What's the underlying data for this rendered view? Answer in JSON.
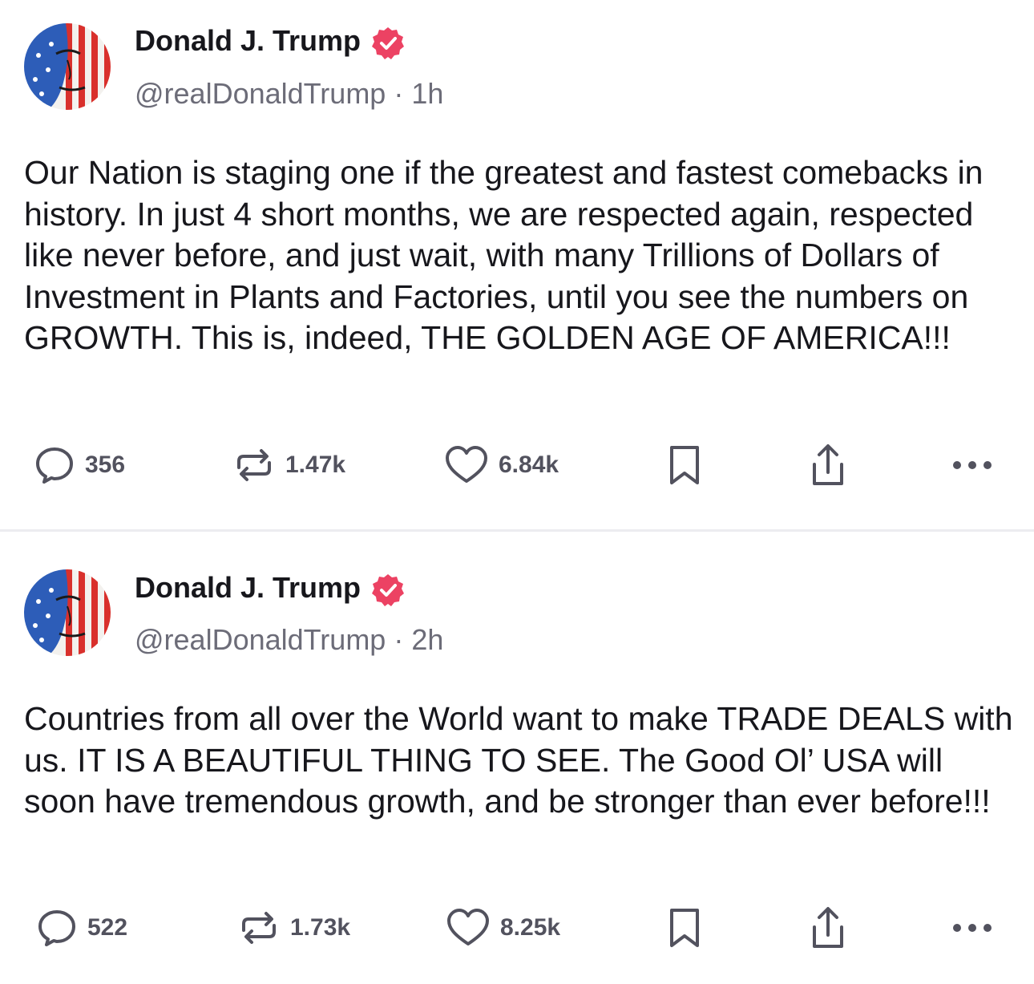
{
  "posts": [
    {
      "author": {
        "name": "Donald J. Trump",
        "handle": "@realDonaldTrump",
        "verified": true
      },
      "time": "1h",
      "text": "Our Nation is staging one if the greatest and fastest comebacks in history. In just 4 short months, we are respected again, respected like never before, and just wait, with many Trillions of Dollars of Investment in Plants and Factories, until you see the numbers on GROWTH. This is, indeed, THE GOLDEN AGE OF AMERICA!!!",
      "stats": {
        "replies": "356",
        "reposts": "1.47k",
        "likes": "6.84k"
      }
    },
    {
      "author": {
        "name": "Donald J. Trump",
        "handle": "@realDonaldTrump",
        "verified": true
      },
      "time": "2h",
      "text": "Countries from all over the World want to make TRADE DEALS with us. IT IS A BEAUTIFUL THING TO SEE. The Good Ol’ USA will soon have tremendous growth, and be stronger than ever before!!!",
      "stats": {
        "replies": "522",
        "reposts": "1.73k",
        "likes": "8.25k"
      }
    }
  ],
  "ui": {
    "separator": "·",
    "icons": [
      "reply-icon",
      "repost-icon",
      "like-icon",
      "bookmark-icon",
      "share-icon",
      "more-icon",
      "verified-badge-icon"
    ],
    "colors": {
      "verified": "#ec4263",
      "text": "#17171c",
      "muted": "#6c6c78",
      "icon": "#52525e",
      "divider": "#ececf0"
    }
  }
}
